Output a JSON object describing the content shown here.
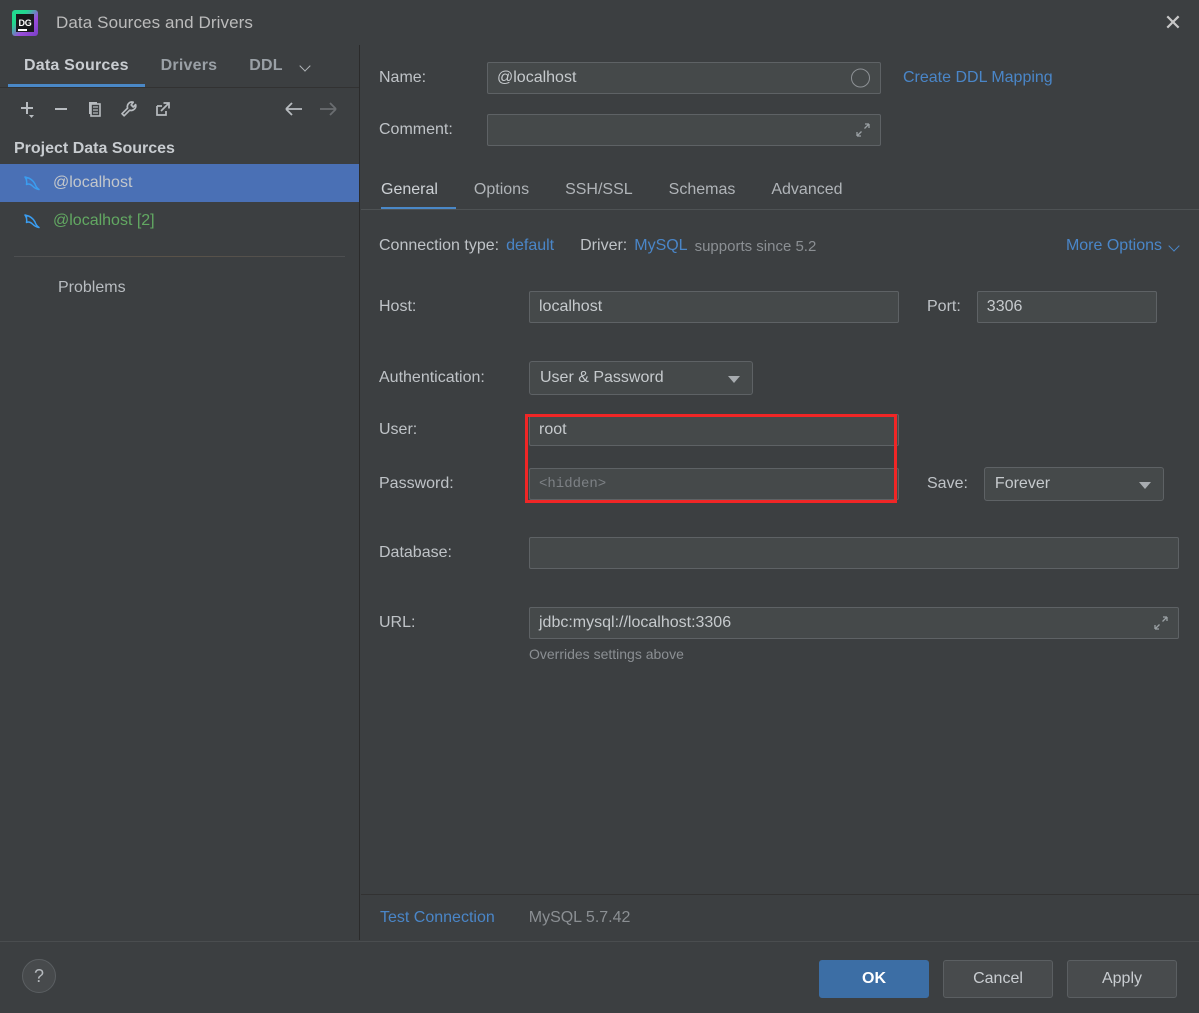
{
  "window": {
    "title": "Data Sources and Drivers",
    "logo_text": "DG",
    "close_label": "✕"
  },
  "left_panel": {
    "tabs": [
      {
        "label": "Data Sources",
        "active": true
      },
      {
        "label": "Drivers",
        "active": false
      },
      {
        "label": "DDL",
        "active": false
      }
    ],
    "tabs_overflow_icon": "chevron-down-icon",
    "toolbar": [
      {
        "name": "add-button",
        "icon": "plus-icon",
        "enabled": true
      },
      {
        "name": "remove-button",
        "icon": "minus-icon",
        "enabled": true
      },
      {
        "name": "duplicate-button",
        "icon": "copy-icon",
        "enabled": true
      },
      {
        "name": "properties-button",
        "icon": "wrench-icon",
        "enabled": true
      },
      {
        "name": "open-external-button",
        "icon": "external-link-icon",
        "enabled": true
      },
      {
        "name": "back-button",
        "icon": "arrow-left-icon",
        "enabled": true
      },
      {
        "name": "forward-button",
        "icon": "arrow-right-icon",
        "enabled": false
      }
    ],
    "section_header": "Project Data Sources",
    "data_sources": [
      {
        "label": "@localhost",
        "icon": "mysql-dolphin-icon",
        "selected": true,
        "color": "#c3c7cb"
      },
      {
        "label": "@localhost [2]",
        "icon": "mysql-dolphin-icon",
        "selected": false,
        "color": "#62a862"
      }
    ],
    "problems_label": "Problems"
  },
  "form": {
    "name_label": "Name:",
    "name_value": "@localhost",
    "create_ddl_mapping": "Create DDL Mapping",
    "comment_label": "Comment:",
    "comment_value": "",
    "tabs": [
      {
        "label": "General",
        "active": true
      },
      {
        "label": "Options",
        "active": false
      },
      {
        "label": "SSH/SSL",
        "active": false
      },
      {
        "label": "Schemas",
        "active": false
      },
      {
        "label": "Advanced",
        "active": false
      }
    ],
    "connection_type_label": "Connection type:",
    "connection_type_value": "default",
    "driver_label": "Driver:",
    "driver_value": "MySQL",
    "driver_support": "supports since 5.2",
    "more_options": "More Options",
    "host_label": "Host:",
    "host_value": "localhost",
    "port_label": "Port:",
    "port_value": "3306",
    "auth_label": "Authentication:",
    "auth_value": "User & Password",
    "user_label": "User:",
    "user_value": "root",
    "password_label": "Password:",
    "password_placeholder": "<hidden>",
    "save_label": "Save:",
    "save_value": "Forever",
    "database_label": "Database:",
    "database_value": "",
    "url_label": "URL:",
    "url_value": "jdbc:mysql://localhost:3306",
    "url_hint": "Overrides settings above"
  },
  "footer": {
    "test_connection": "Test Connection",
    "server_version": "MySQL 5.7.42",
    "help_label": "?",
    "ok_label": "OK",
    "cancel_label": "Cancel",
    "apply_label": "Apply"
  },
  "annotation": {
    "accent_color": "#f02626",
    "target": "user-password-fields"
  },
  "colors": {
    "background": "#3c3f41",
    "selection": "#4a70b5",
    "link": "#4a86c8",
    "tab_underline": "#4a88c7",
    "primary_button": "#3c6ea5",
    "green_text": "#62a862",
    "annotation": "#f02626"
  }
}
